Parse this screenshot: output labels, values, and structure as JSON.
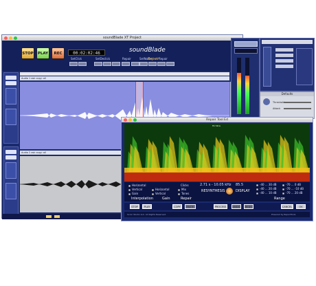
{
  "main_window": {
    "title": "soundBlade XT Project",
    "traffic_colors": [
      "#ff5f57",
      "#ffbd2e",
      "#28c940"
    ]
  },
  "transport": {
    "stop_label": "STOP",
    "play_label": "PLAY",
    "rec_label": "REC",
    "timecode": "00:02:02:46",
    "groups": {
      "setclick": "SetClick",
      "setdeclick": "SetDeclick",
      "repair": "Repair",
      "setnoise": "SetNoise",
      "repair2": "Repair"
    }
  },
  "logo": {
    "text": "soundBlade",
    "sub": "Repair"
  },
  "tracks": [
    {
      "name": "Audio 1 ask copy: all",
      "muted": false
    },
    {
      "name": "Audio 2 ask copy: all",
      "muted": true
    }
  ],
  "defaults_panel": {
    "title": "Defaults",
    "threshold_label": "Threshold",
    "attack_label": "Attack"
  },
  "repair_tool": {
    "title": "Repair Tool Ed",
    "spectro_caption": "Hz Slice",
    "interpolation": {
      "label": "Interpolation",
      "options": [
        "Horizontal",
        "Vertical",
        "Gain"
      ],
      "selected": "Horizontal"
    },
    "gain": {
      "label": "Gain",
      "options": [
        "Horizontal",
        "Vertical",
        "Both"
      ]
    },
    "repair": {
      "label": "Repair",
      "options": [
        "Clicks",
        "Mix",
        "Tones"
      ]
    },
    "readout": "2.71 s - 10.05 kHz",
    "readout_db": "85.5",
    "resynthesis_label": "RESYNTHESIS",
    "display_label": "DISPLAY",
    "range": {
      "label": "Range",
      "options": [
        "-40 ... 30 dB",
        "-40 ... 20 dB",
        "-40 ... 10 dB",
        "-70 ... 0 dB",
        "-70 ... -10 dB",
        "-70 ... 20 dB"
      ]
    },
    "buttons": {
      "stop": "STOP",
      "play": "PLAY",
      "copy": "COPY",
      "paste": "PASTE",
      "process": "PROCESS",
      "undo": "UNDO",
      "redo": "REDO",
      "cancel": "CANCEL",
      "ok": "OK"
    },
    "footer_left": "Sonic Studio LLC. All Rights Reserved.",
    "footer_right": "Powered by RepairTools"
  },
  "colors": {
    "window_bg": "#1a2a6e",
    "wave_bg_selected": "#8a8ee0",
    "wave_bg": "#c8c9cc",
    "accent": "#ffd060"
  }
}
